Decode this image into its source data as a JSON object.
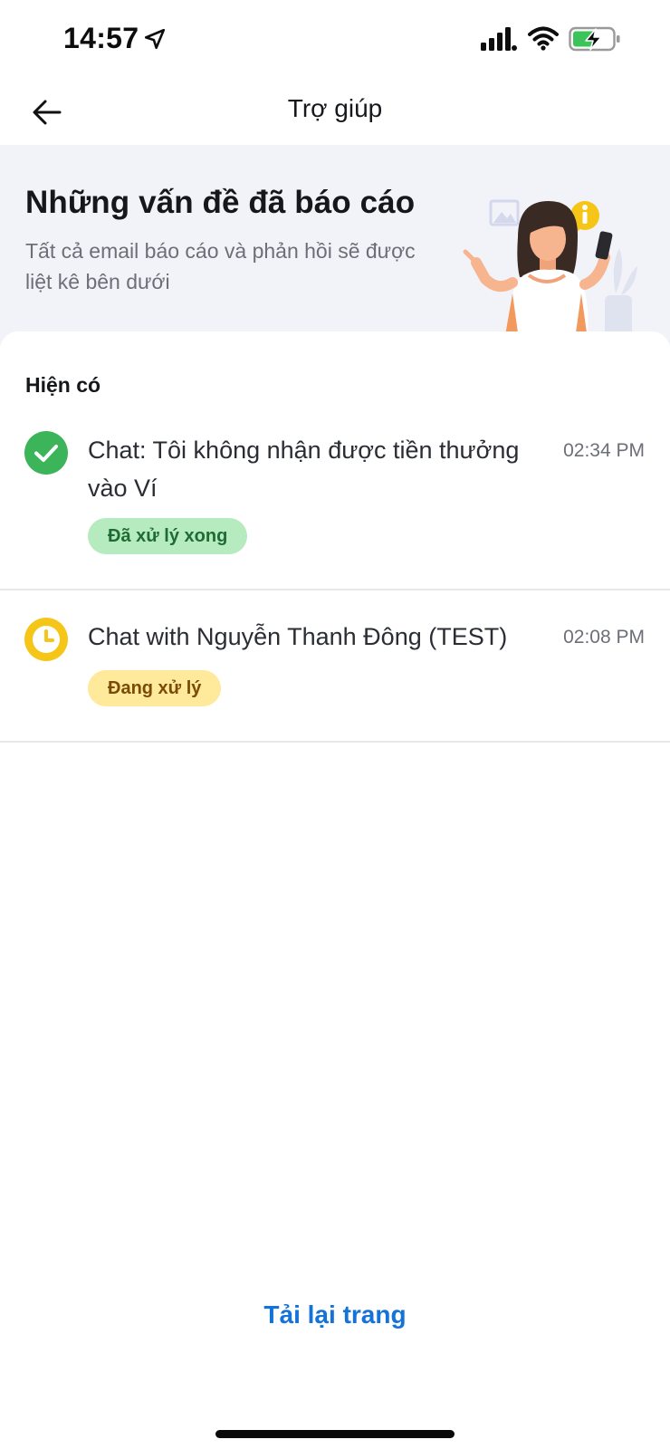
{
  "status_bar": {
    "time": "14:57",
    "icons": [
      "location-arrow-icon",
      "signal-icon",
      "wifi-icon",
      "battery-charging-icon"
    ],
    "battery_color": "#3cc45a"
  },
  "nav": {
    "title": "Trợ giúp",
    "back_icon": "arrow-left-icon"
  },
  "hero": {
    "title": "Những vấn đề đã báo cáo",
    "subtitle": "Tất cả email báo cáo và phản hồi sẽ được liệt kê bên dưới",
    "illustration": "woman-with-phone-illustration"
  },
  "section": {
    "label": "Hiện có"
  },
  "tickets": [
    {
      "title": "Chat: Tôi không nhận được tiền thưởng vào Ví",
      "time": "02:34 PM",
      "status": "Đã xử lý xong",
      "status_icon": "check-circle-icon",
      "status_color": "#3bb45a"
    },
    {
      "title": "Chat with Nguyễn Thanh Đông (TEST)",
      "time": "02:08 PM",
      "status": "Đang xử lý",
      "status_icon": "clock-icon",
      "status_color": "#f5c518"
    }
  ],
  "footer": {
    "reload_label": "Tải lại trang",
    "link_color": "#1572d6"
  }
}
